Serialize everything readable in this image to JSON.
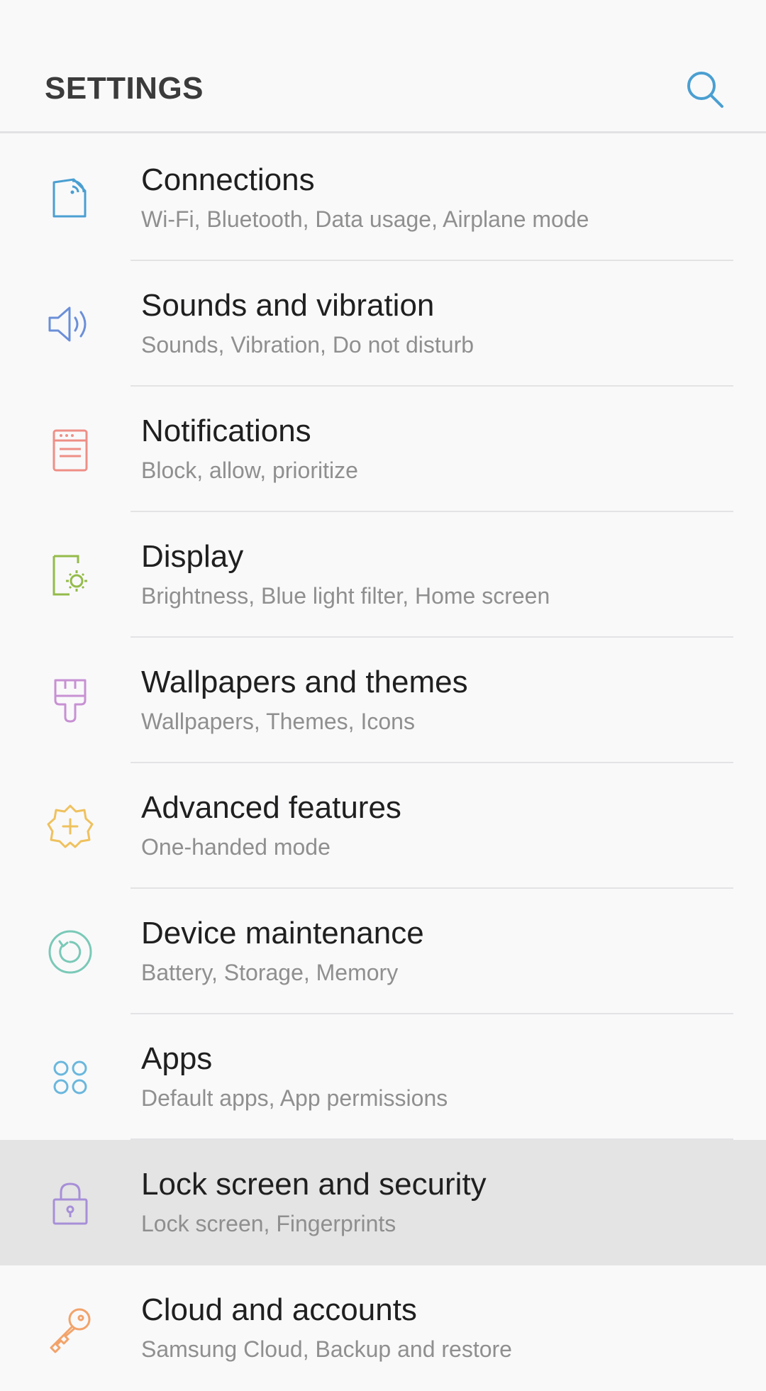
{
  "header": {
    "title": "SETTINGS",
    "search_icon": "search-icon"
  },
  "colors": {
    "connections": "#4a9fd1",
    "sounds": "#6b8fd8",
    "notifications": "#ee8f86",
    "display": "#94bb4a",
    "wallpapers": "#c891d3",
    "advanced": "#efc15e",
    "maintenance": "#7ac9b7",
    "apps": "#6ab7dd",
    "lock": "#a78fd8",
    "cloud": "#f2a36a"
  },
  "items": [
    {
      "id": "connections",
      "label": "Connections",
      "sub": "Wi-Fi, Bluetooth, Data usage, Airplane mode",
      "icon": "connections-icon"
    },
    {
      "id": "sounds",
      "label": "Sounds and vibration",
      "sub": "Sounds, Vibration, Do not disturb",
      "icon": "speaker-icon"
    },
    {
      "id": "notifications",
      "label": "Notifications",
      "sub": "Block, allow, prioritize",
      "icon": "notifications-icon"
    },
    {
      "id": "display",
      "label": "Display",
      "sub": "Brightness, Blue light filter, Home screen",
      "icon": "display-icon"
    },
    {
      "id": "wallpapers",
      "label": "Wallpapers and themes",
      "sub": "Wallpapers, Themes, Icons",
      "icon": "paintbrush-icon"
    },
    {
      "id": "advanced",
      "label": "Advanced features",
      "sub": "One-handed mode",
      "icon": "gear-plus-icon"
    },
    {
      "id": "maintenance",
      "label": "Device maintenance",
      "sub": "Battery, Storage, Memory",
      "icon": "refresh-circle-icon"
    },
    {
      "id": "apps",
      "label": "Apps",
      "sub": "Default apps, App permissions",
      "icon": "apps-grid-icon"
    },
    {
      "id": "lock",
      "label": "Lock screen and security",
      "sub": "Lock screen, Fingerprints",
      "icon": "lock-icon",
      "active": true
    },
    {
      "id": "cloud",
      "label": "Cloud and accounts",
      "sub": "Samsung Cloud, Backup and restore",
      "icon": "key-icon"
    }
  ]
}
